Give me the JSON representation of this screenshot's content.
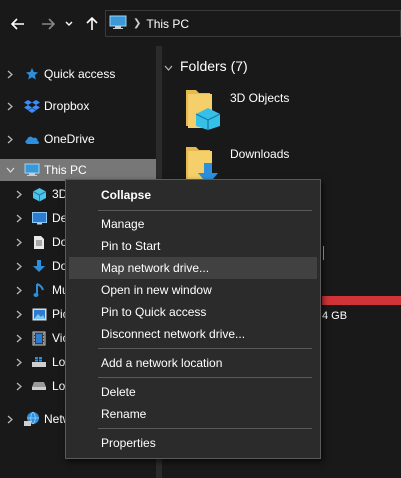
{
  "address": {
    "breadcrumb": "This PC"
  },
  "sidebar": {
    "items": [
      {
        "label": "Quick access"
      },
      {
        "label": "Dropbox"
      },
      {
        "label": "OneDrive"
      },
      {
        "label": "This PC"
      },
      {
        "label": "3D"
      },
      {
        "label": "De"
      },
      {
        "label": "Do"
      },
      {
        "label": "Do"
      },
      {
        "label": "Mu"
      },
      {
        "label": "Pic"
      },
      {
        "label": "Vic"
      },
      {
        "label": "Lo"
      },
      {
        "label": "Lo"
      },
      {
        "label": "Netw"
      }
    ]
  },
  "main": {
    "section_title": "Folders (7)",
    "folders": [
      {
        "label": "3D Objects"
      },
      {
        "label": "Downloads"
      }
    ],
    "drive_size_text": "4 GB",
    "drive_fill_color": "#d13438"
  },
  "context_menu": {
    "items": [
      {
        "label": "Collapse"
      },
      {
        "label": "Manage"
      },
      {
        "label": "Pin to Start"
      },
      {
        "label": "Map network drive..."
      },
      {
        "label": "Open in new window"
      },
      {
        "label": "Pin to Quick access"
      },
      {
        "label": "Disconnect network drive..."
      },
      {
        "label": "Add a network location"
      },
      {
        "label": "Delete"
      },
      {
        "label": "Rename"
      },
      {
        "label": "Properties"
      }
    ]
  }
}
